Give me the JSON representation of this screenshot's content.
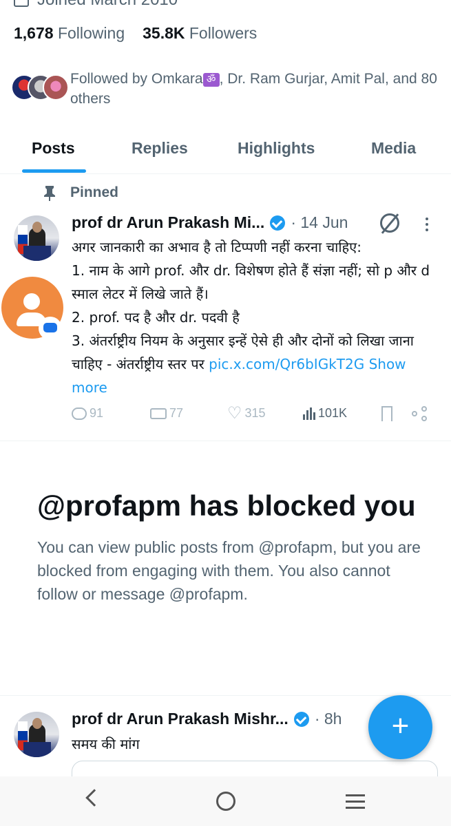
{
  "profile": {
    "joined": "Joined March 2010",
    "following_count": "1,678",
    "following_label": "Following",
    "followers_count": "35.8K",
    "followers_label": "Followers",
    "followed_by_prefix": "Followed by Omkara",
    "followed_by_suffix": ", Dr. Ram Gurjar, Amit Pal, and 80 others"
  },
  "tabs": [
    {
      "label": "Posts",
      "active": true
    },
    {
      "label": "Replies",
      "active": false
    },
    {
      "label": "Highlights",
      "active": false
    },
    {
      "label": "Media",
      "active": false
    }
  ],
  "pinned_post": {
    "pinned_label": "Pinned",
    "name": "prof dr Arun Prakash Mi...",
    "time": "· 14 Jun",
    "lines": [
      "अगर जानकारी का अभाव है तो टिप्पणी नहीं करना चाहिए:",
      "1. नाम के आगे prof. और dr.  विशेषण होते हैं संज्ञा नहीं; सो p और d स्माल लेटर में लिखे जाते हैं।",
      "2. prof. पद है और dr. पदवी है",
      "3. अंतर्राष्ट्रीय नियम के अनुसार इन्हें ऐसे ही और दोनों को लिखा जाना चाहिए  - अंतर्राष्ट्रीय स्तर पर "
    ],
    "link": "pic.x.com/Qr6bIGkT2G",
    "show_more": "Show more",
    "replies": "91",
    "reposts": "77",
    "likes": "315",
    "views": "101K"
  },
  "blocked": {
    "title": "@profapm has blocked you",
    "message": "You can view public posts from @profapm, but you are blocked from engaging with them. You also cannot follow or message @profapm."
  },
  "second_post": {
    "name": "prof dr Arun Prakash Mishr...",
    "time": "· 8h",
    "text": "समय की मांग"
  },
  "compose_label": "+",
  "colors": {
    "accent": "#1d9bf0",
    "secondary_text": "#536471",
    "contact_fab": "#f08a40"
  }
}
